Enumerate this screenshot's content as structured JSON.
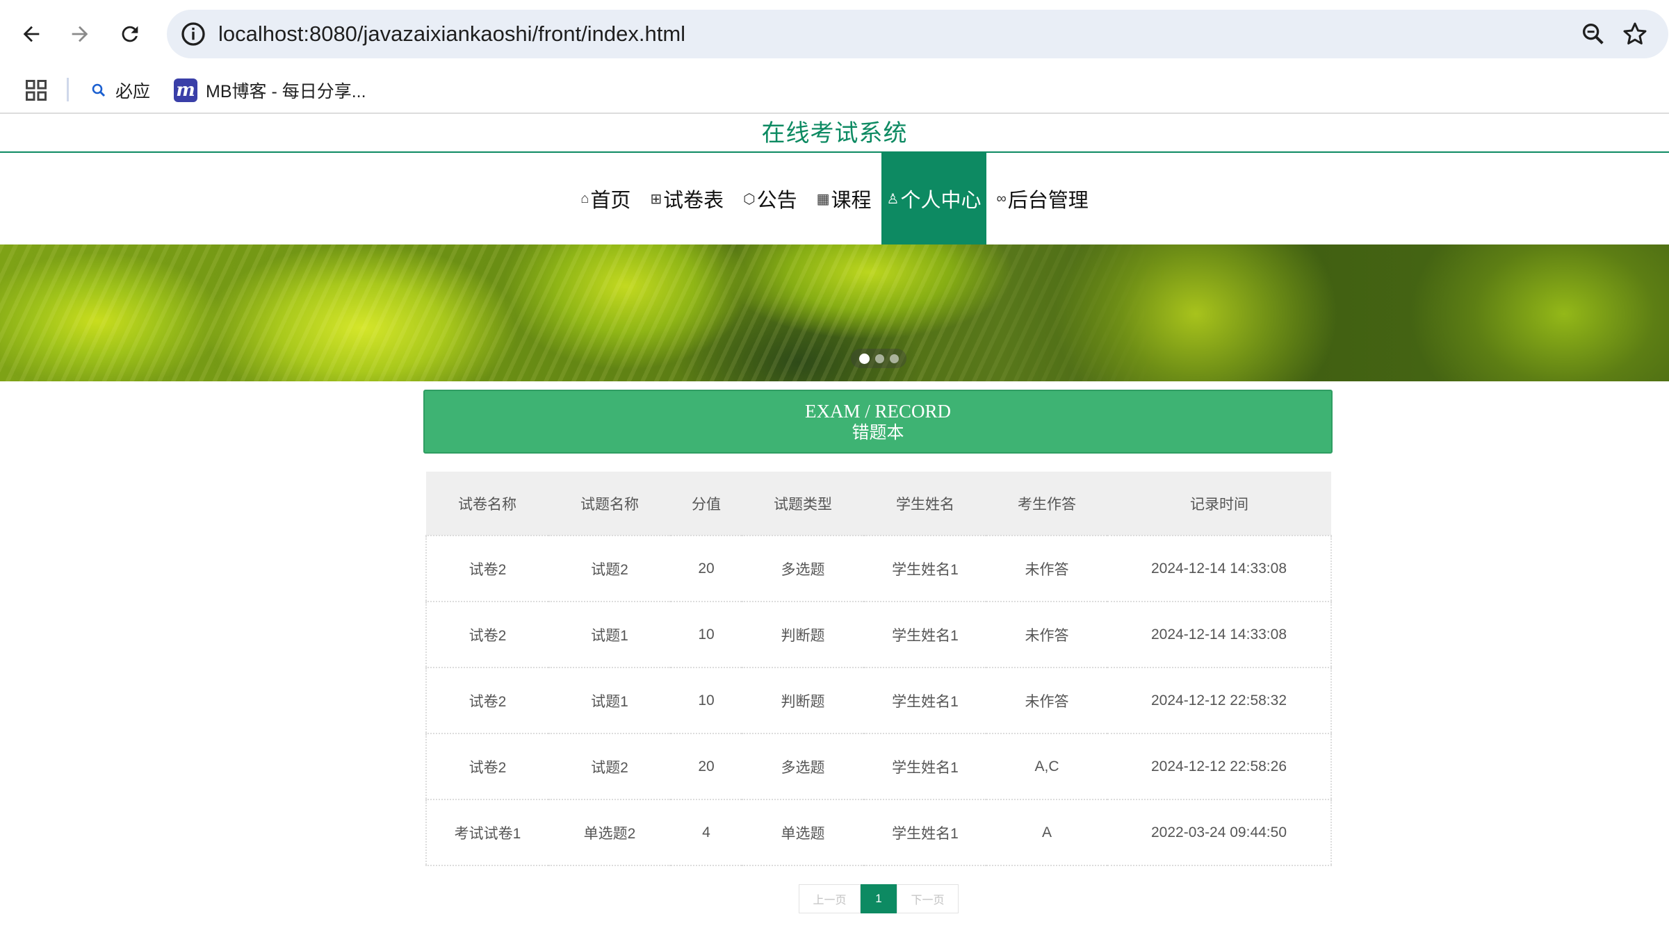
{
  "browser": {
    "url": "localhost:8080/javazaixiankaoshi/front/index.html",
    "bookmarks": [
      {
        "label": "必应",
        "icon": "search-icon"
      },
      {
        "label": "MB博客 - 每日分享...",
        "icon": "mb-logo-icon",
        "logo_text": "m"
      }
    ]
  },
  "site": {
    "title": "在线考试系统",
    "accent_color": "#0d8a62",
    "header_green": "#3eb373"
  },
  "nav": {
    "items": [
      {
        "label": "首页",
        "icon": "home-icon"
      },
      {
        "label": "试卷表",
        "icon": "grid-icon"
      },
      {
        "label": "公告",
        "icon": "cube-icon"
      },
      {
        "label": "课程",
        "icon": "gift-icon"
      },
      {
        "label": "个人中心",
        "icon": "user-icon",
        "active": true
      },
      {
        "label": "后台管理",
        "icon": "link-icon"
      }
    ]
  },
  "banner": {
    "slides": 3,
    "current_slide": 1
  },
  "section": {
    "title_en": "EXAM / RECORD",
    "title_cn": "错题本"
  },
  "table": {
    "headers": [
      "试卷名称",
      "试题名称",
      "分值",
      "试题类型",
      "学生姓名",
      "考生作答",
      "记录时间"
    ],
    "rows": [
      [
        "试卷2",
        "试题2",
        "20",
        "多选题",
        "学生姓名1",
        "未作答",
        "2024-12-14 14:33:08"
      ],
      [
        "试卷2",
        "试题1",
        "10",
        "判断题",
        "学生姓名1",
        "未作答",
        "2024-12-14 14:33:08"
      ],
      [
        "试卷2",
        "试题1",
        "10",
        "判断题",
        "学生姓名1",
        "未作答",
        "2024-12-12 22:58:32"
      ],
      [
        "试卷2",
        "试题2",
        "20",
        "多选题",
        "学生姓名1",
        "A,C",
        "2024-12-12 22:58:26"
      ],
      [
        "考试试卷1",
        "单选题2",
        "4",
        "单选题",
        "学生姓名1",
        "A",
        "2022-03-24 09:44:50"
      ]
    ]
  },
  "pagination": {
    "prev": "上一页",
    "current": "1",
    "next": "下一页"
  }
}
